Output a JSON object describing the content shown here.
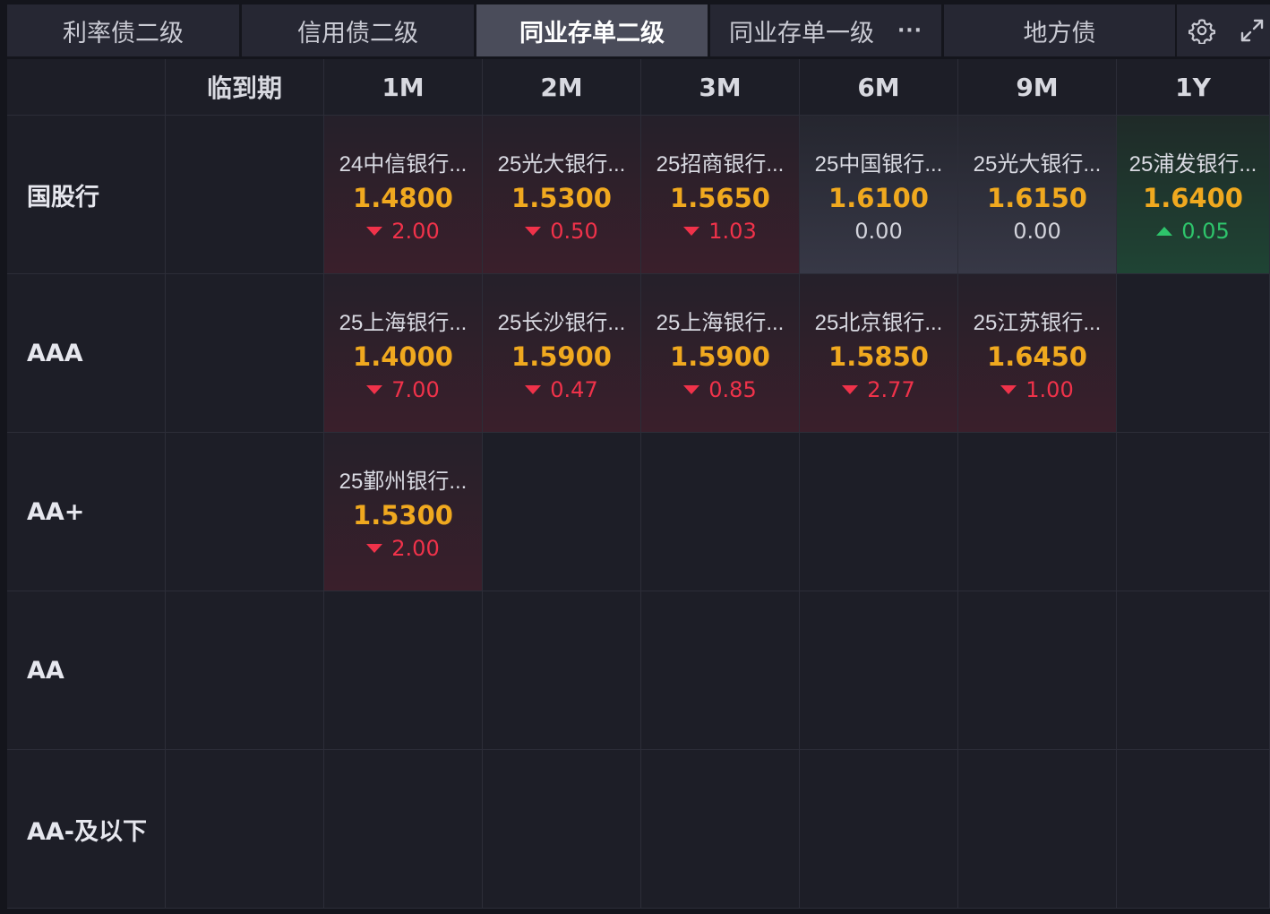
{
  "tabs": [
    {
      "label": "利率债二级",
      "active": false
    },
    {
      "label": "信用债二级",
      "active": false
    },
    {
      "label": "同业存单二级",
      "active": true
    },
    {
      "label": "同业存单一级",
      "active": false,
      "more": "···"
    },
    {
      "label": "地方债",
      "active": false
    }
  ],
  "toolbar": {
    "settings_icon": "gear-icon",
    "expand_icon": "expand-icon"
  },
  "grid": {
    "columns": [
      "",
      "临到期",
      "1M",
      "2M",
      "3M",
      "6M",
      "9M",
      "1Y"
    ],
    "rows": [
      {
        "label": "国股行",
        "cells": [
          null,
          {
            "name": "24中信银行...",
            "yield": "1.4800",
            "change": "2.00",
            "dir": "down"
          },
          {
            "name": "25光大银行...",
            "yield": "1.5300",
            "change": "0.50",
            "dir": "down"
          },
          {
            "name": "25招商银行...",
            "yield": "1.5650",
            "change": "1.03",
            "dir": "down"
          },
          {
            "name": "25中国银行...",
            "yield": "1.6100",
            "change": "0.00",
            "dir": "flat"
          },
          {
            "name": "25光大银行...",
            "yield": "1.6150",
            "change": "0.00",
            "dir": "flat"
          },
          {
            "name": "25浦发银行...",
            "yield": "1.6400",
            "change": "0.05",
            "dir": "up"
          }
        ]
      },
      {
        "label": "AAA",
        "cells": [
          null,
          {
            "name": "25上海银行...",
            "yield": "1.4000",
            "change": "7.00",
            "dir": "down"
          },
          {
            "name": "25长沙银行...",
            "yield": "1.5900",
            "change": "0.47",
            "dir": "down"
          },
          {
            "name": "25上海银行...",
            "yield": "1.5900",
            "change": "0.85",
            "dir": "down"
          },
          {
            "name": "25北京银行...",
            "yield": "1.5850",
            "change": "2.77",
            "dir": "down"
          },
          {
            "name": "25江苏银行...",
            "yield": "1.6450",
            "change": "1.00",
            "dir": "down"
          },
          null
        ]
      },
      {
        "label": "AA+",
        "cells": [
          null,
          {
            "name": "25鄞州银行...",
            "yield": "1.5300",
            "change": "2.00",
            "dir": "down"
          },
          null,
          null,
          null,
          null,
          null
        ]
      },
      {
        "label": "AA",
        "cells": [
          null,
          null,
          null,
          null,
          null,
          null,
          null
        ]
      },
      {
        "label": "AA-及以下",
        "cells": [
          null,
          null,
          null,
          null,
          null,
          null,
          null
        ]
      }
    ]
  }
}
